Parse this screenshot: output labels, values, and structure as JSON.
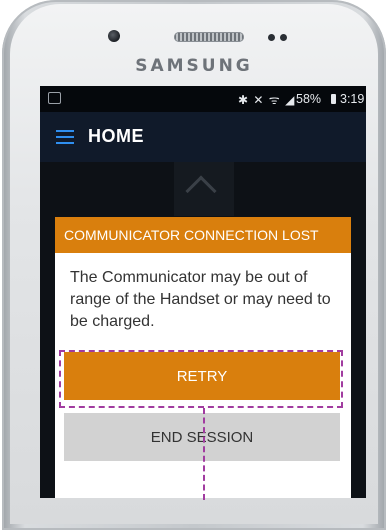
{
  "device": {
    "brand": "SAMSUNG"
  },
  "status_bar": {
    "icons": "✱ ✕ ᯤ ◢",
    "battery": "58%",
    "time": "3:19 PM"
  },
  "app_bar": {
    "title": "HOME"
  },
  "dialog": {
    "title": "COMMUNICATOR CONNECTION LOST",
    "message": "The Communicator may be out of range of the Handset or may need to be charged.",
    "retry_label": "RETRY",
    "end_session_label": "END SESSION"
  },
  "annotation": {
    "highlight_color": "#a13ca0"
  },
  "colors": {
    "accent": "#d97f0d",
    "menu": "#2f8ff0",
    "screen_bg": "#0d1116"
  }
}
